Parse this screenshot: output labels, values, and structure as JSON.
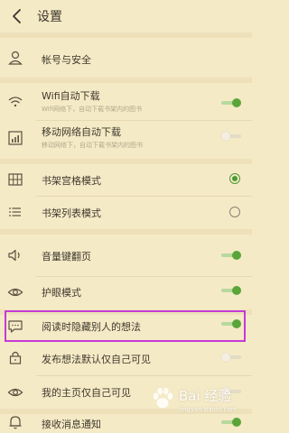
{
  "header": {
    "title": "设置"
  },
  "rows": {
    "account": {
      "label": "帐号与安全"
    },
    "wifi_download": {
      "label": "Wifi自动下载",
      "sub": "Wifi网络下，自动下载书架内的图书",
      "toggle": "on"
    },
    "mobile_download": {
      "label": "移动网络自动下载",
      "sub": "移动网络下，自动下载书架内的图书",
      "toggle": "off"
    },
    "grid_mode": {
      "label": "书架宫格模式",
      "selected": true
    },
    "list_mode": {
      "label": "书架列表模式",
      "selected": false
    },
    "volume_flip": {
      "label": "音量键翻页",
      "toggle": "on"
    },
    "eye_protect": {
      "label": "护眼模式",
      "toggle": "on"
    },
    "hide_thoughts": {
      "label": "阅读时隐藏别人的想法",
      "toggle": "on"
    },
    "private_thoughts": {
      "label": "发布想法默认仅自己可见",
      "toggle": "off"
    },
    "private_homepage": {
      "label": "我的主页仅自己可见",
      "toggle": "off"
    },
    "notifications": {
      "label": "接收消息通知",
      "toggle": "on"
    }
  },
  "watermark": {
    "text": "Bai 经验",
    "sub": "jingyan.baidu.com"
  },
  "colors": {
    "background": "#f5eac6",
    "toggle_on": "#5aa53a",
    "highlight": "#c53ad6"
  }
}
